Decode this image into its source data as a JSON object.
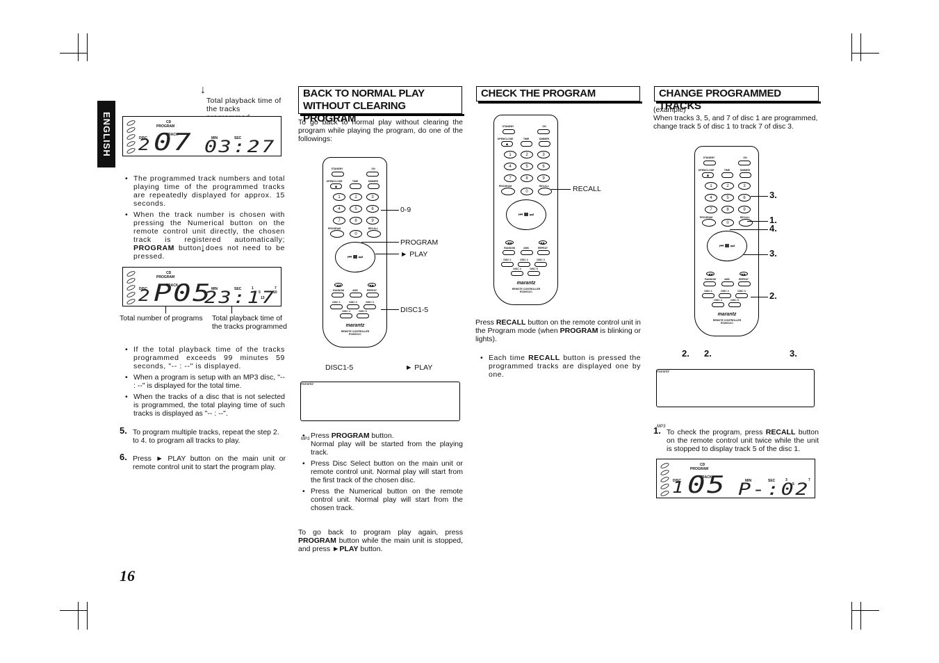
{
  "page": {
    "number": "16",
    "language_tab": "ENGLISH"
  },
  "left": {
    "note1": "Total playback time of the tracks programmed",
    "display1": {
      "cd": "CD",
      "program": "PROGRAM",
      "disc": "DISC",
      "track": "TRACK",
      "min": "MIN",
      "sec": "SEC",
      "disc_num": "2",
      "track_num": "07",
      "time": "03:27",
      "cal": [
        "7"
      ]
    },
    "bullets1": [
      "The programmed track numbers and total playing time of the programmed tracks are repeatedly displayed for approx. 15 seconds.",
      "When the track number is chosen with pressing the Numerical button on the remote control unit directly, the chosen track is registered automatically; PROGRAM button does not need to be pressed."
    ],
    "display2": {
      "cd": "CD",
      "program": "PROGRAM",
      "disc": "DISC",
      "track": "TRACK",
      "min": "MIN",
      "sec": "SEC",
      "disc_num": "2",
      "track_num": "P05",
      "time": "23:17",
      "cal": [
        "1",
        "5",
        "7",
        "10",
        "13"
      ]
    },
    "caption_programs": "Total number of programs",
    "caption_time": "Total playback time of the tracks programmed",
    "bullets2": [
      "If the total playback time of the tracks programmed exceeds 99 minutes 59 seconds, \"-- : --\" is displayed.",
      "When a program is setup with an MP3 disc, \"-- : --\" is displayed for the total time.",
      "When the tracks of a disc that is not selected is programmed, the total playing time of such tracks is displayed as \"-- : --\"."
    ],
    "step5": {
      "num": "5.",
      "text": "To program multiple tracks, repeat the step 2. to 4. to program all tracks to play."
    },
    "step6": {
      "num": "6.",
      "text": "Press ► PLAY button on the main unit or remote control unit to start the program play."
    }
  },
  "back": {
    "title": "BACK TO NORMAL PLAY WITHOUT CLEARING PROGRAM",
    "intro": "To go back to normal play without clearing the program while playing the program, do one of the followings:",
    "callouts": [
      "0-9",
      "PROGRAM",
      "► PLAY",
      "DISC1-5"
    ],
    "unit_callouts": [
      "DISC1-5",
      "► PLAY"
    ],
    "bullets": [
      "Press PROGRAM button. Normal play will be started from the playing track.",
      "Press Disc Select button on the main unit or remote control unit. Normal play will start from the first track of the chosen disc.",
      "Press the Numerical button on the remote control unit. Normal play will start from the chosen track."
    ],
    "outro": "To go back to program play again, press PROGRAM button while the main unit is stopped, and press ►PLAY button."
  },
  "check": {
    "title": "CHECK THE PROGRAM",
    "callout": "RECALL",
    "text": "Press RECALL button on the remote control unit in the Program mode (when PROGRAM is blinking or lights).",
    "bullet": "Each time RECALL button is pressed the programmed tracks are displayed one by one."
  },
  "change": {
    "title": "CHANGE PROGRAMMED TRACKS",
    "example": "(example)",
    "intro": "When tracks 3, 5, and 7 of disc 1 are programmed, change track 5 of disc 1 to track 7 of disc 3.",
    "remote_steps": [
      "3.",
      "1.",
      "4.",
      "3.",
      "2."
    ],
    "unit_steps": [
      "2.",
      "2.",
      "3."
    ],
    "step1": {
      "num": "1.",
      "text": "To check the program, press RECALL button on the remote control unit twice while the unit is stopped to display track 5 of the disc 1."
    },
    "display3": {
      "cd": "CD",
      "program": "PROGRAM",
      "disc": "DISC",
      "track": "TRACK",
      "min": "MIN",
      "sec": "SEC",
      "disc_num": "1",
      "track_num": "05",
      "time": "P-:02",
      "cal": [
        "3",
        "5",
        "7"
      ]
    }
  },
  "remote": {
    "standby": "STANDBY",
    "on": "ON",
    "open_close": "OPEN/CLOSE",
    "time": "TIME",
    "dimmer": "DIMMER",
    "keys": [
      "1",
      "2",
      "3",
      "4",
      "5",
      "6",
      "7",
      "8",
      "9"
    ],
    "program": "PROGRAM",
    "zero": "0",
    "recall": "RECALL",
    "random": "RANDOM",
    "ams": "AMS",
    "repeat": "REPEAT",
    "discs": [
      "DISC 1",
      "DISC 2",
      "DISC 3",
      "DISC 4",
      "DISC 5"
    ],
    "brand": "marantz",
    "model": "REMOTE CONTROLLER RC6001CC"
  },
  "unit": {
    "brand": "marantz",
    "mp3": "MP3"
  }
}
